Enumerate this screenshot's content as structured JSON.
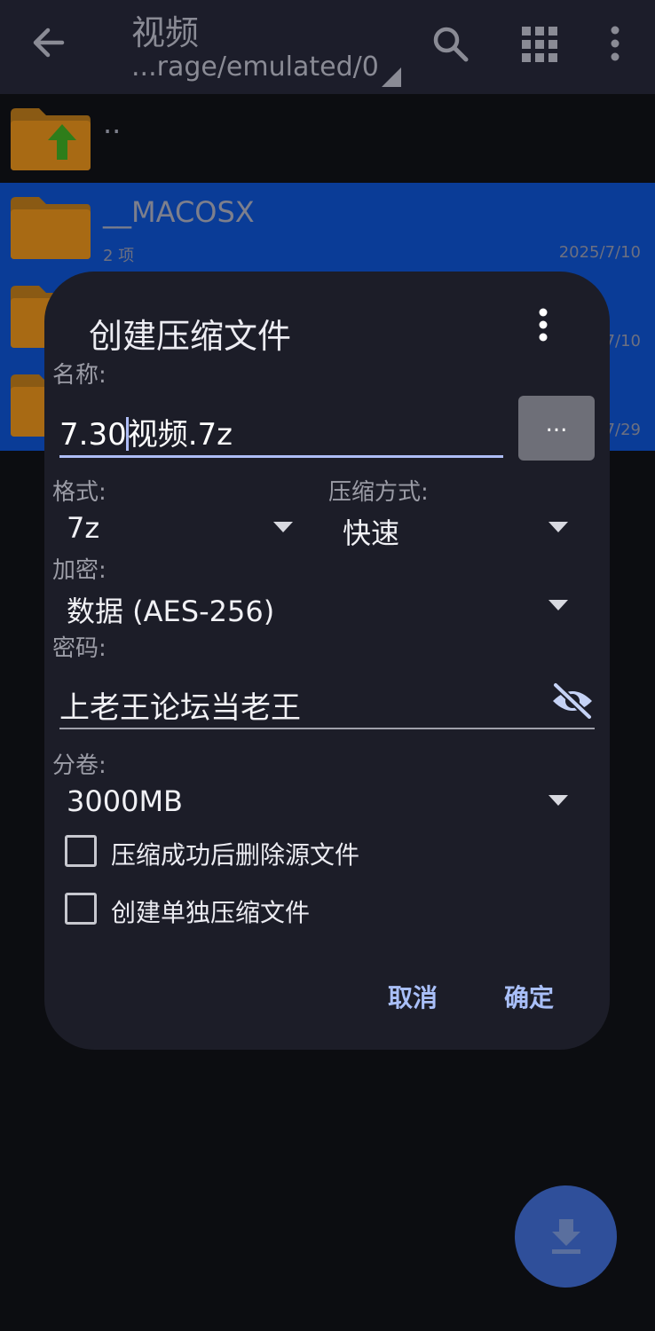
{
  "header": {
    "title": "视频",
    "path": "...rage/emulated/0",
    "icons": [
      "back-arrow-icon",
      "search-icon",
      "grid-view-icon",
      "more-vert-icon"
    ]
  },
  "files": {
    "up_label": "..",
    "rows": [
      {
        "name": "__MACOSX",
        "sub": "2 项",
        "date": "2025/7/10"
      },
      {
        "name": "",
        "sub": "",
        "date": "7/10"
      },
      {
        "name": "",
        "sub": "",
        "date": "7/29"
      }
    ]
  },
  "dialog": {
    "title": "创建压缩文件",
    "name_label": "名称:",
    "name_value_before": "7.30",
    "name_value_after": "视频.7z",
    "browse_label": "...",
    "format_label": "格式:",
    "format_value": "7z",
    "method_label": "压缩方式:",
    "method_value": "快速",
    "encrypt_label": "加密:",
    "encrypt_value": "数据 (AES-256)",
    "password_label": "密码:",
    "password_value": "上老王论坛当老王",
    "volume_label": "分卷:",
    "volume_value": "3000MB",
    "delete_source_label": "压缩成功后删除源文件",
    "delete_source_checked": false,
    "separate_label": "创建单独压缩文件",
    "separate_checked": false,
    "cancel_label": "取消",
    "ok_label": "确定"
  },
  "colors": {
    "accent": "#a9bff8",
    "selected_row": "#0a3c97",
    "folder": "#a86a14",
    "fab": "#2f4f9a"
  }
}
